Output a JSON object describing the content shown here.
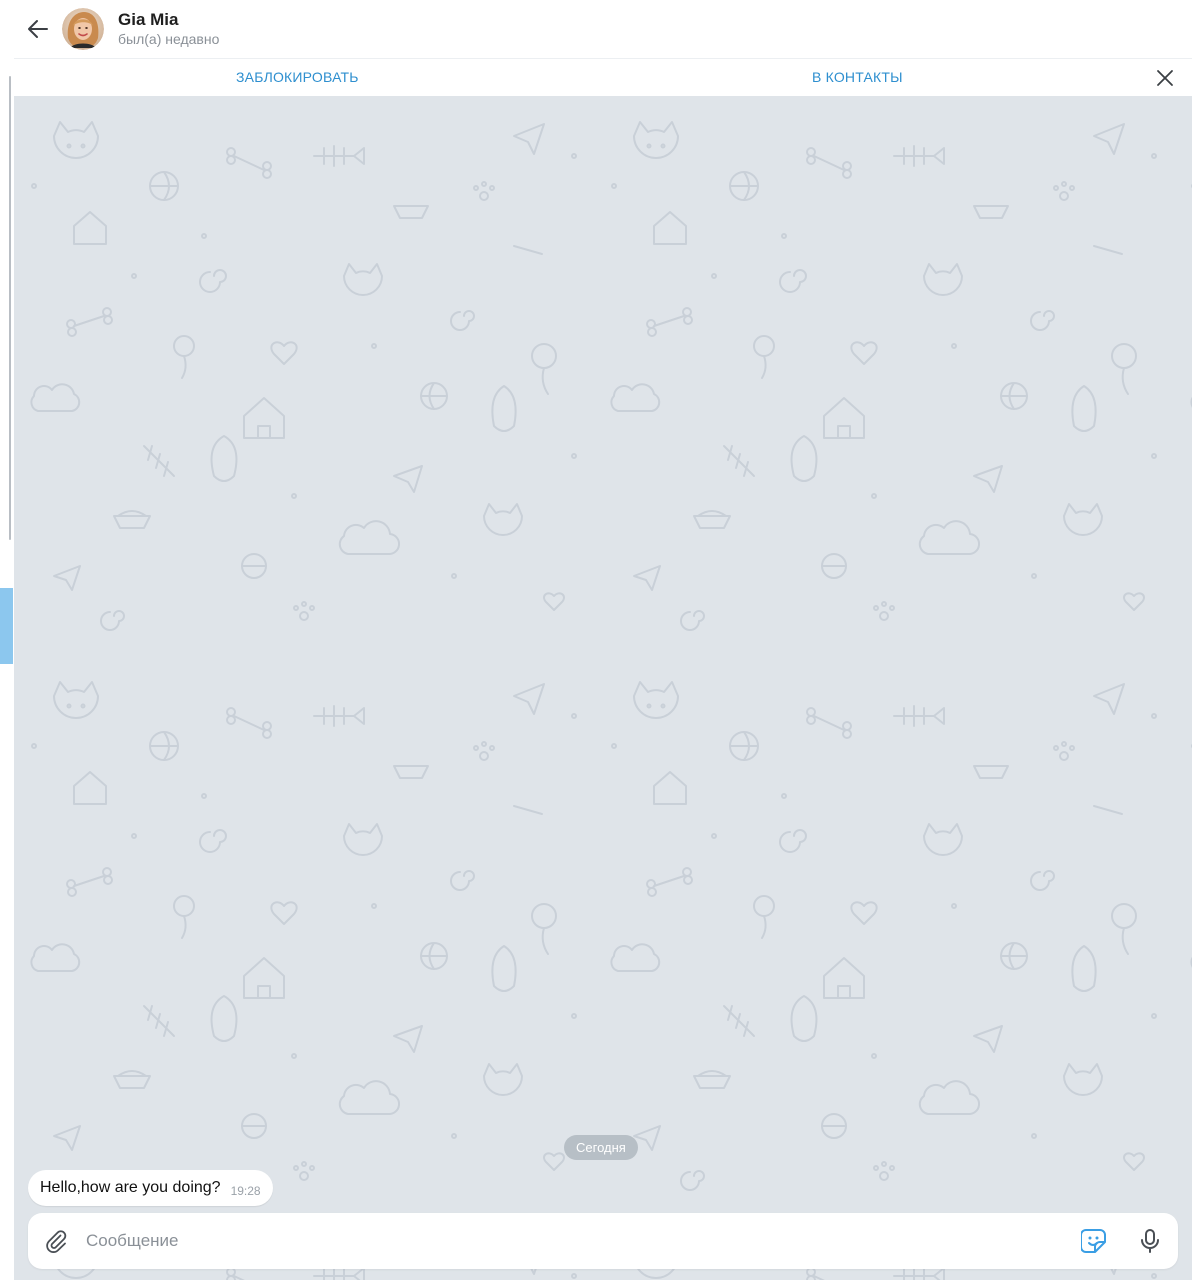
{
  "header": {
    "peer_name": "Gia Mia",
    "peer_status": "был(а) недавно",
    "back_icon": "arrow-left-icon",
    "avatar": "avatar-photo"
  },
  "action_bar": {
    "block_label": "ЗАБЛОКИРОВАТЬ",
    "add_contact_label": "В КОНТАКТЫ",
    "close_icon": "close-icon"
  },
  "chat": {
    "date_separator": "Сегодня",
    "messages": [
      {
        "text": "Hello,how are you doing?",
        "time": "19:28",
        "direction": "incoming"
      }
    ],
    "background": "doodle-pattern"
  },
  "composer": {
    "placeholder": "Сообщение",
    "attach_icon": "paperclip-icon",
    "sticker_icon": "sticker-icon",
    "mic_icon": "microphone-icon"
  },
  "colors": {
    "accent": "#2e8fcf",
    "chat_background": "#dfe4e9",
    "sticker_icon": "#3a9ee4"
  }
}
